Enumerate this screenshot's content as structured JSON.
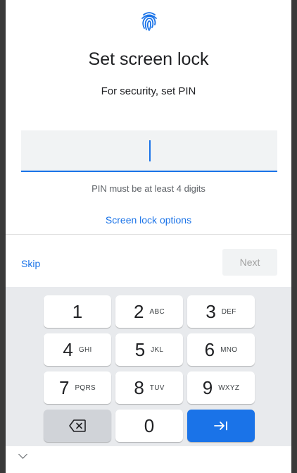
{
  "header": {
    "icon": "fingerprint-icon",
    "title": "Set screen lock",
    "subtitle": "For security, set PIN"
  },
  "pin": {
    "value": "",
    "hint": "PIN must be at least 4 digits"
  },
  "links": {
    "screen_lock_options": "Screen lock options"
  },
  "actions": {
    "skip_label": "Skip",
    "next_label": "Next"
  },
  "keypad": {
    "keys": [
      {
        "digit": "1",
        "letters": ""
      },
      {
        "digit": "2",
        "letters": "ABC"
      },
      {
        "digit": "3",
        "letters": "DEF"
      },
      {
        "digit": "4",
        "letters": "GHI"
      },
      {
        "digit": "5",
        "letters": "JKL"
      },
      {
        "digit": "6",
        "letters": "MNO"
      },
      {
        "digit": "7",
        "letters": "PQRS"
      },
      {
        "digit": "8",
        "letters": "TUV"
      },
      {
        "digit": "9",
        "letters": "WXYZ"
      },
      {
        "digit": "0",
        "letters": ""
      }
    ],
    "backspace_icon": "backspace-icon",
    "enter_icon": "tab-enter-icon"
  },
  "nav": {
    "collapse_icon": "chevron-down-icon"
  },
  "colors": {
    "accent": "#1a73e8",
    "keypad_bg": "#e8eaed"
  }
}
